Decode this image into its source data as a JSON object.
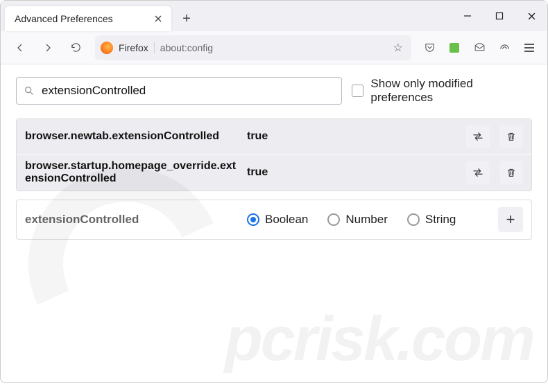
{
  "window": {
    "tab_title": "Advanced Preferences"
  },
  "urlbar": {
    "identity": "Firefox",
    "url": "about:config"
  },
  "filter": {
    "value": "extensionControlled",
    "show_modified_label": "Show only modified preferences"
  },
  "prefs": [
    {
      "name": "browser.newtab.extensionControlled",
      "value": "true"
    },
    {
      "name": "browser.startup.homepage_override.extensionControlled",
      "value": "true"
    }
  ],
  "add": {
    "name": "extensionControlled",
    "types": [
      "Boolean",
      "Number",
      "String"
    ],
    "selected": "Boolean"
  },
  "watermark": "pcrisk.com"
}
